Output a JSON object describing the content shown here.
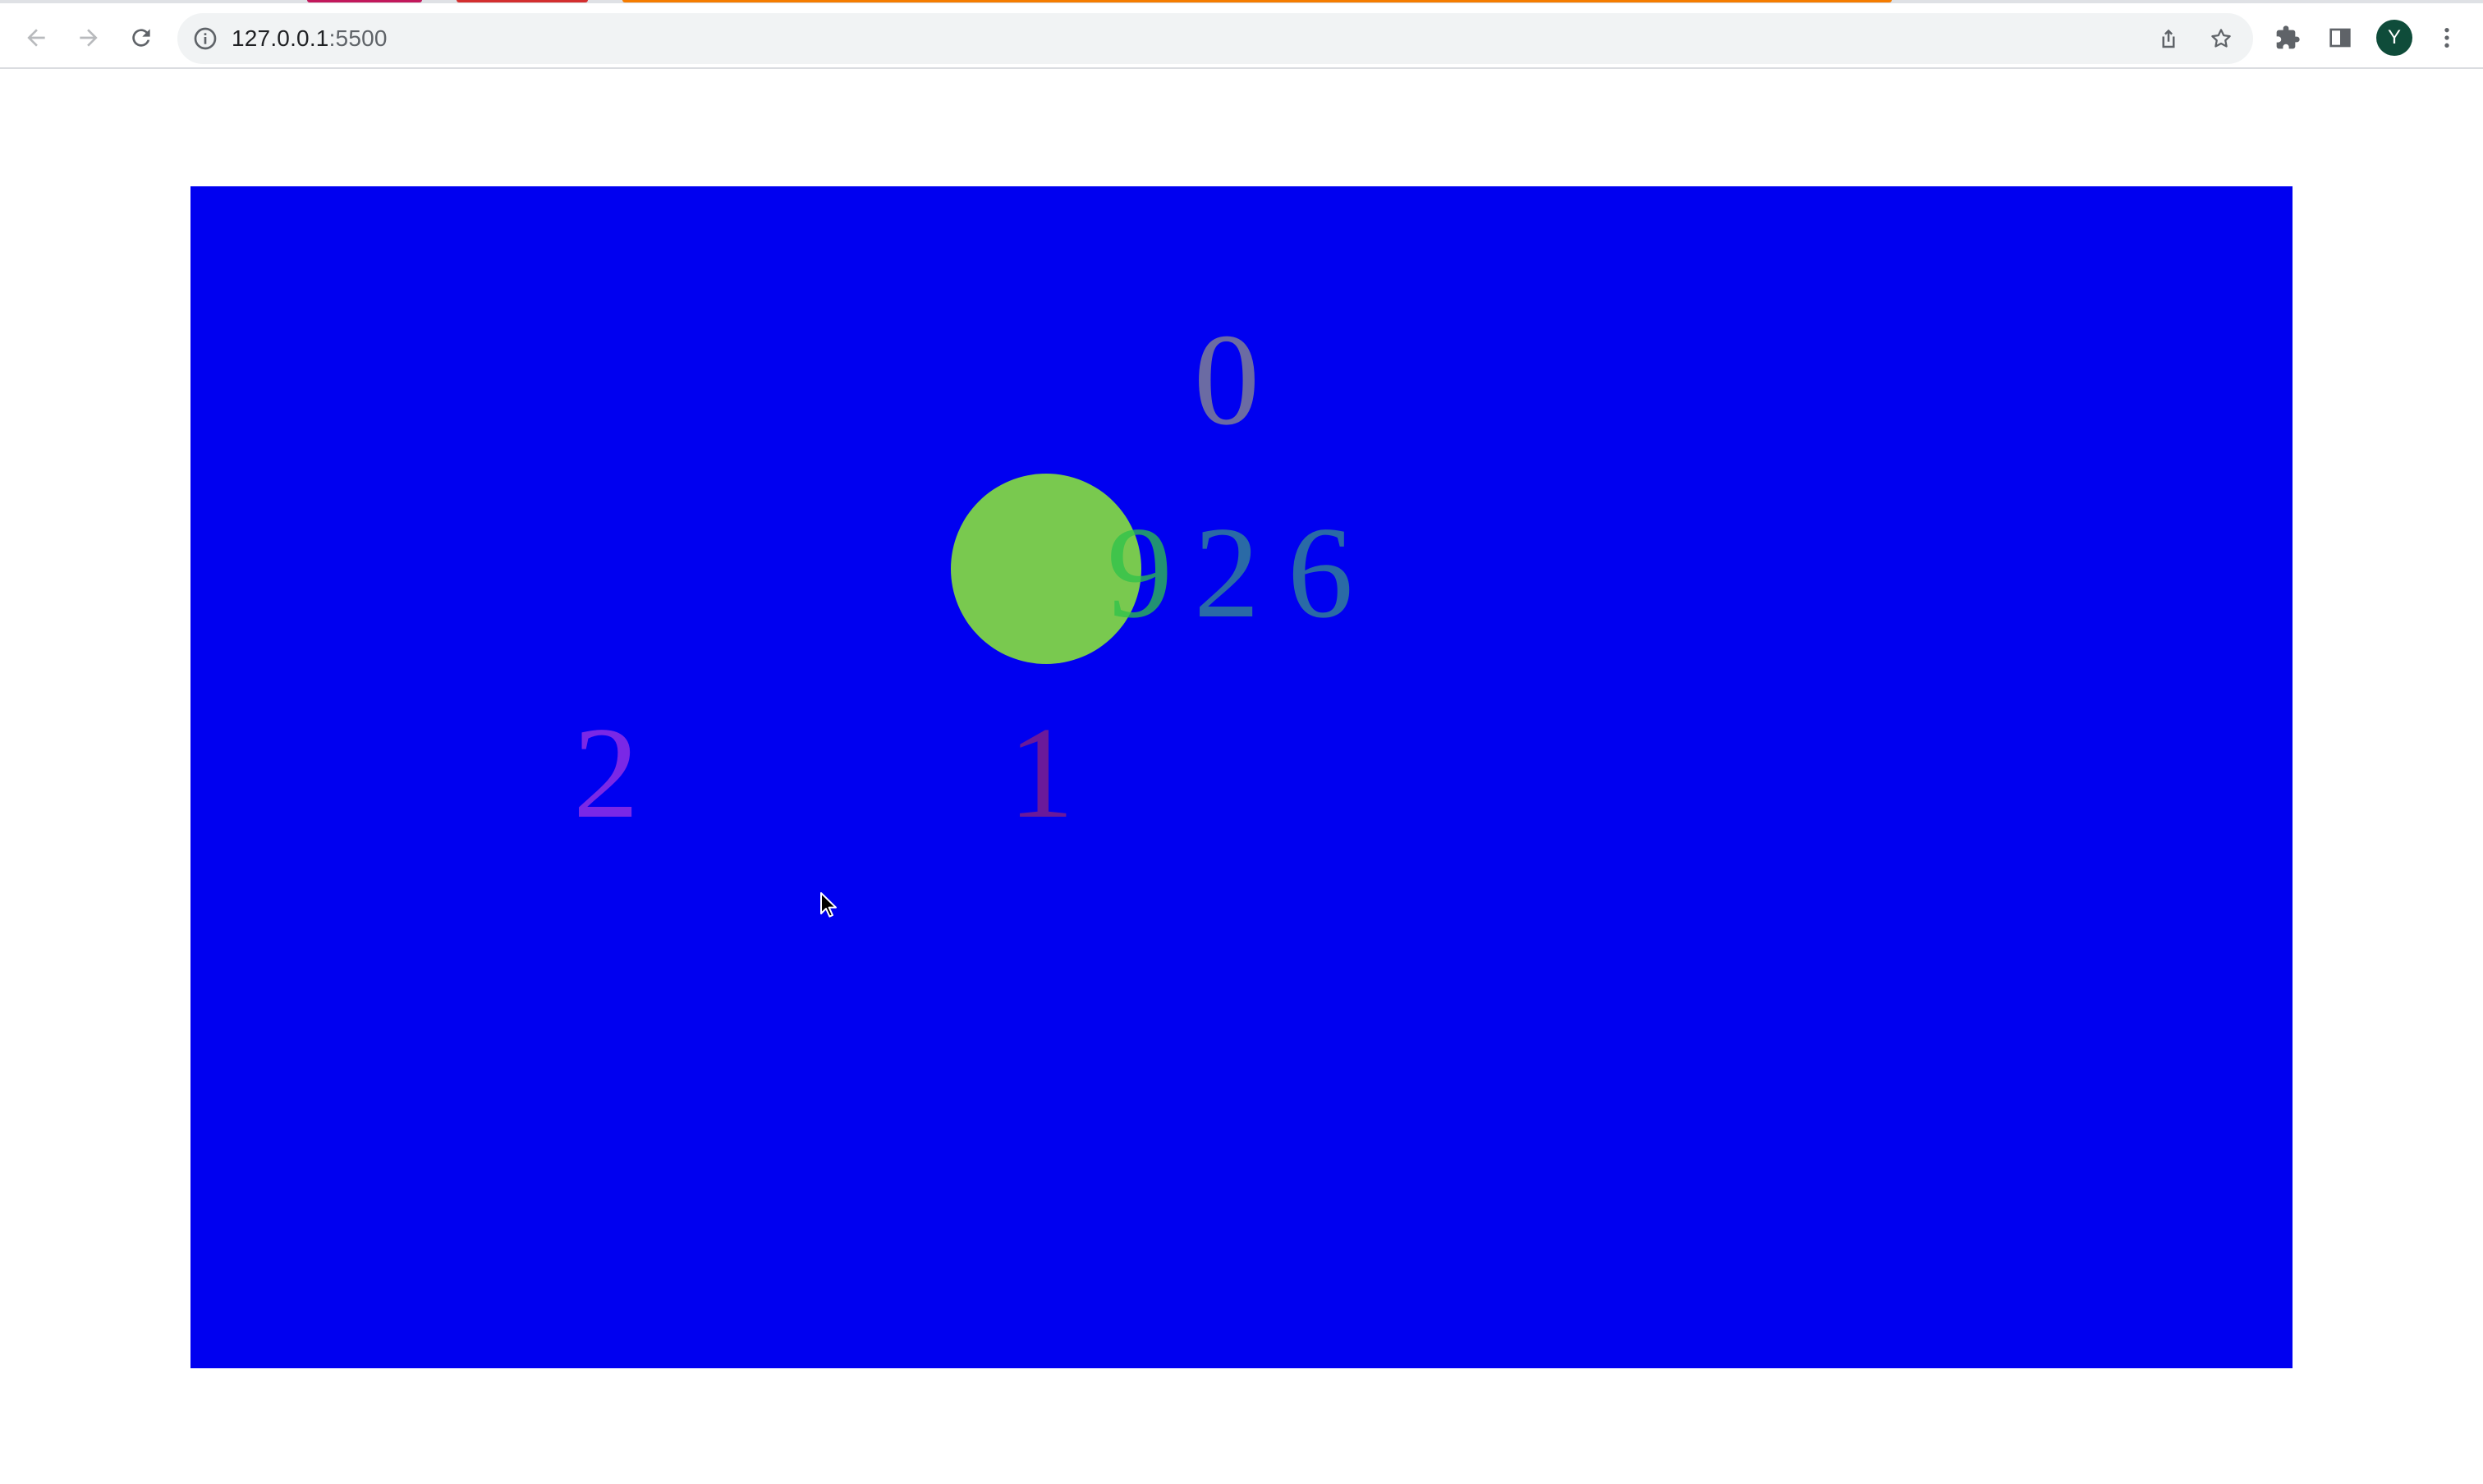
{
  "browser": {
    "url_host": "127.0.0.1",
    "url_port": ":5500",
    "profile_initial": "Y",
    "tab_hint_colors": [
      "#c2185b",
      "#d32f2f",
      "#f57c00"
    ]
  },
  "page": {
    "background_color": "#0000f0",
    "digits": [
      {
        "text": "0",
        "color": "#6b6ba3"
      },
      {
        "text": "9",
        "color": "#2ec34a"
      },
      {
        "text": "2",
        "color": "#2a6aa6"
      },
      {
        "text": "6",
        "color": "#2a6aa6"
      },
      {
        "text": "2",
        "color": "#7a28e6"
      },
      {
        "text": "1",
        "color": "#6a1a9a"
      }
    ],
    "ball": {
      "color": "#79c94f"
    }
  }
}
